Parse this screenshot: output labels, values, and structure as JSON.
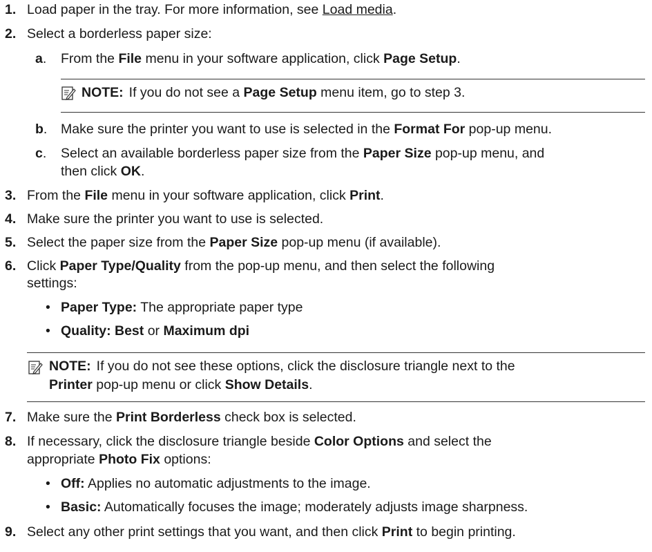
{
  "steps": [
    {
      "num": "1.",
      "text_a": "Load paper in the tray. For more information, see ",
      "link": "Load media",
      "text_b": "."
    },
    {
      "num": "2.",
      "text": "Select a borderless paper size:"
    },
    {
      "num": "3.",
      "p1": "From the ",
      "b1": "File",
      "p2": " menu in your software application, click ",
      "b2": "Print",
      "p3": "."
    },
    {
      "num": "4.",
      "text": "Make sure the printer you want to use is selected."
    },
    {
      "num": "5.",
      "p1": "Select the paper size from the ",
      "b1": "Paper Size",
      "p2": " pop-up menu (if available)."
    },
    {
      "num": "6.",
      "b1": "Paper Type/Quality",
      "p1": "Click ",
      "p2": " from the pop-up menu, and then select the following",
      "line2": "settings:"
    },
    {
      "num": "7.",
      "p1": "Make sure the ",
      "b1": "Print Borderless",
      "p2": " check box is selected."
    },
    {
      "num": "8.",
      "p1": "If necessary, click the disclosure triangle beside ",
      "b1": "Color Options",
      "p2": " and select the",
      "l2a": "appropriate ",
      "l2b": "Photo Fix",
      "l2c": " options:"
    },
    {
      "num": "9.",
      "p1": "Select any other print settings that you want, and then click ",
      "b1": "Print",
      "p2": " to begin printing."
    }
  ],
  "substeps": [
    {
      "letter": "a",
      "sep": ".",
      "p1": "From the ",
      "b1": "File",
      "p2": " menu in your software application, click ",
      "b2": "Page Setup",
      "p3": "."
    },
    {
      "letter": "b",
      "sep": ".",
      "p1": "Make sure the printer you want to use is selected in the ",
      "b1": "Format For",
      "p2": " pop-up menu."
    },
    {
      "letter": "c",
      "sep": ".",
      "p1": "Select an available borderless paper size from the ",
      "b1": "Paper Size",
      "p2": " pop-up menu, and",
      "l2a": "then click ",
      "l2b": "OK",
      "l2c": "."
    }
  ],
  "note1": {
    "label": "NOTE:",
    "p1": "If you do not see a ",
    "b1": "Page Setup",
    "p2": " menu item, go to step 3."
  },
  "bullets6": [
    {
      "b1": "Paper Type:",
      "p1": " The appropriate paper type"
    },
    {
      "b1": "Quality: Best",
      "p1": " or ",
      "b2": "Maximum dpi"
    }
  ],
  "note2": {
    "label": "NOTE:",
    "p1": "If you do not see these options, click the disclosure triangle next to the",
    "b1": "Printer",
    "p2": " pop-up menu or click ",
    "b2": "Show Details",
    "p3": "."
  },
  "bullets8": [
    {
      "b1": "Off:",
      "p1": " Applies no automatic adjustments to the image."
    },
    {
      "b1": "Basic:",
      "p1": " Automatically focuses the image; moderately adjusts image sharpness."
    }
  ],
  "bullet_char": "•",
  "icons": {
    "note": "note-pencil-icon"
  }
}
